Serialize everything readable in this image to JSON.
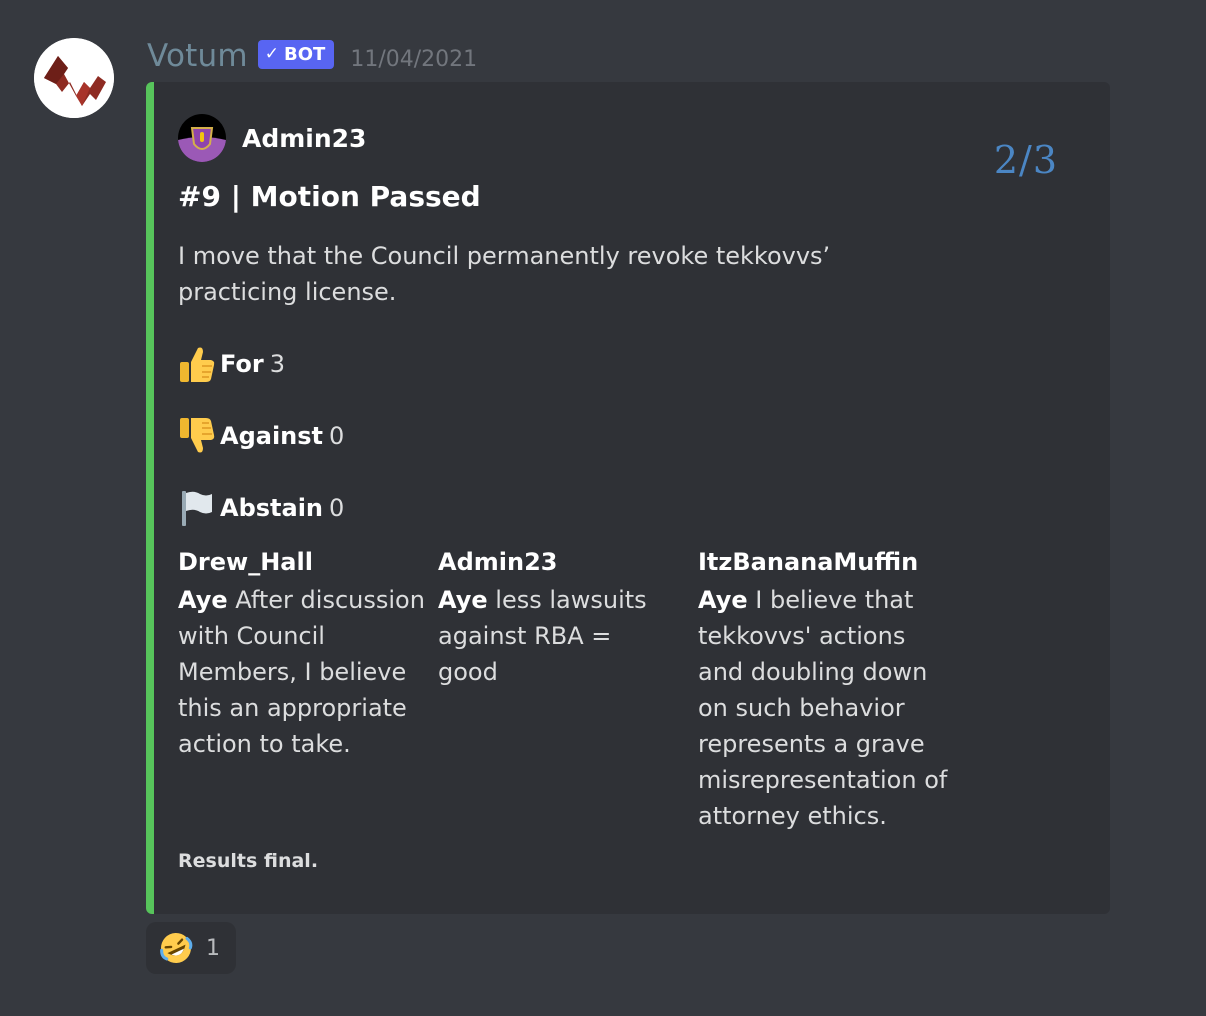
{
  "message": {
    "username": "Votum",
    "bot_tag": "BOT",
    "timestamp": "11/04/2021"
  },
  "embed": {
    "accent_color": "#57c45b",
    "author": "Admin23",
    "page_indicator": "2/3",
    "title": "#9 | Motion Passed",
    "description": "I move that the Council permanently revoke tekkovvs’ practicing license.",
    "tallies": [
      {
        "icon": "thumbs-up-icon",
        "label": "For",
        "count": "3"
      },
      {
        "icon": "thumbs-down-icon",
        "label": "Against",
        "count": "0"
      },
      {
        "icon": "white-flag-icon",
        "label": "Abstain",
        "count": "0"
      }
    ],
    "votes": [
      {
        "name": "Drew_Hall",
        "vote": "Aye",
        "reason": "After discussion with Council Members, I believe this an appropriate action to take."
      },
      {
        "name": "Admin23",
        "vote": "Aye",
        "reason": "less lawsuits against RBA = good"
      },
      {
        "name": "ItzBananaMuffin",
        "vote": "Aye",
        "reason": "I believe that tekkovvs' actions and doubling down on such behavior represents a grave misrepresentation of attorney ethics."
      }
    ],
    "footer": "Results final."
  },
  "reactions": [
    {
      "icon": "rolling-on-floor-laughing-icon",
      "count": "1"
    }
  ]
}
